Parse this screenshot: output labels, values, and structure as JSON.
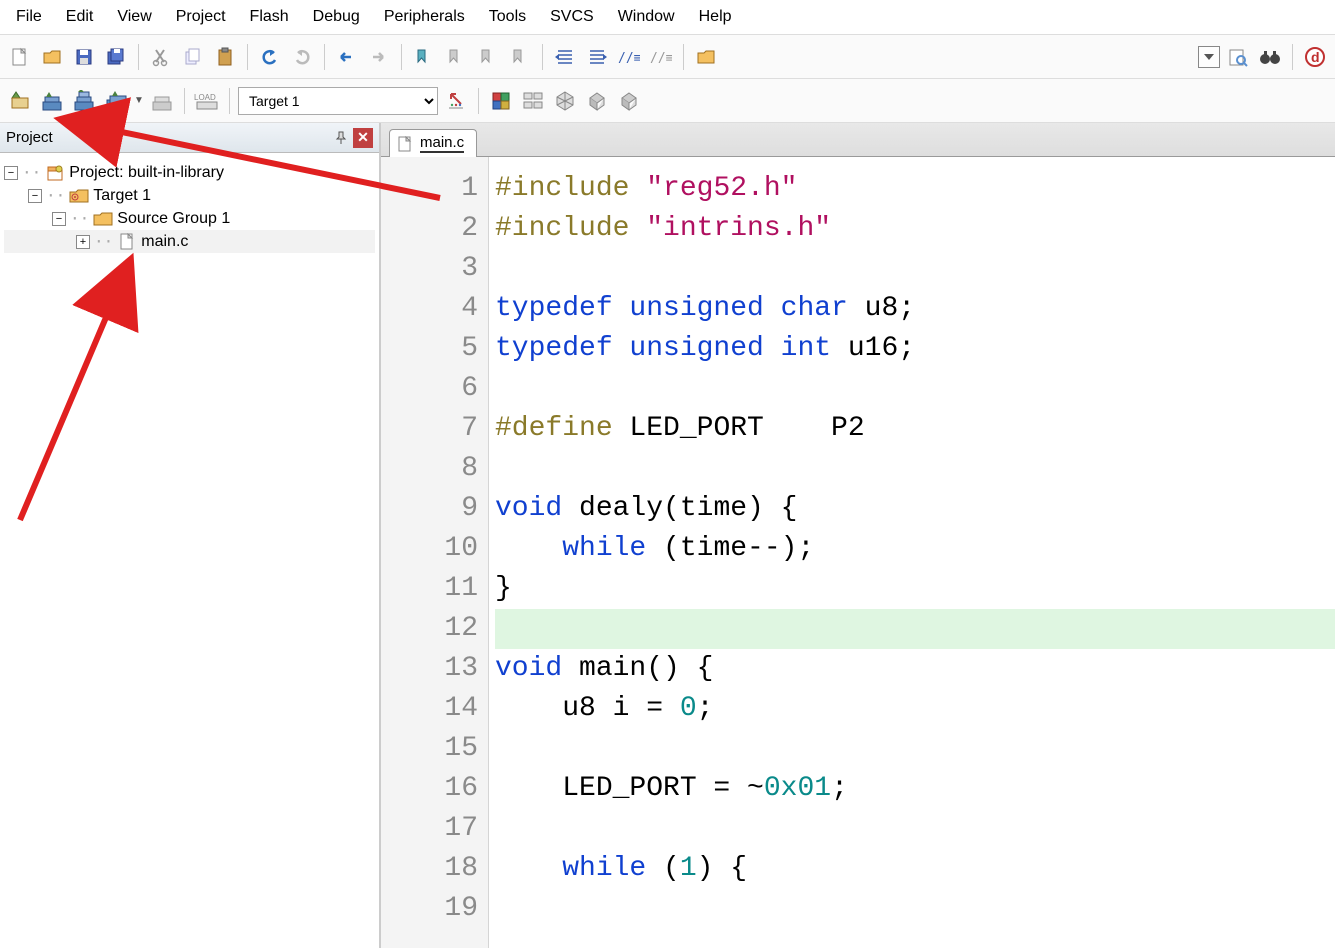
{
  "menu": [
    "File",
    "Edit",
    "View",
    "Project",
    "Flash",
    "Debug",
    "Peripherals",
    "Tools",
    "SVCS",
    "Window",
    "Help"
  ],
  "target_select": "Target 1",
  "sidebar": {
    "title": "Project",
    "project_label": "Project: built-in-library",
    "target_label": "Target 1",
    "group_label": "Source Group 1",
    "file_label": "main.c"
  },
  "tab": {
    "name": "main.c"
  },
  "code": {
    "lines": [
      {
        "n": 1,
        "frags": [
          {
            "t": "#include ",
            "c": "pp"
          },
          {
            "t": "\"reg52.h\"",
            "c": "str"
          }
        ]
      },
      {
        "n": 2,
        "frags": [
          {
            "t": "#include ",
            "c": "pp"
          },
          {
            "t": "\"intrins.h\"",
            "c": "str"
          }
        ]
      },
      {
        "n": 3,
        "frags": []
      },
      {
        "n": 4,
        "frags": [
          {
            "t": "typedef unsigned char",
            "c": "kw"
          },
          {
            "t": " u8;",
            "c": "id"
          }
        ]
      },
      {
        "n": 5,
        "frags": [
          {
            "t": "typedef unsigned int",
            "c": "kw"
          },
          {
            "t": " u16;",
            "c": "id"
          }
        ]
      },
      {
        "n": 6,
        "frags": []
      },
      {
        "n": 7,
        "frags": [
          {
            "t": "#define",
            "c": "pp"
          },
          {
            "t": " LED_PORT    P2",
            "c": "id"
          }
        ]
      },
      {
        "n": 8,
        "frags": []
      },
      {
        "n": 9,
        "frags": [
          {
            "t": "void",
            "c": "kw"
          },
          {
            "t": " dealy(time) {",
            "c": "id"
          }
        ]
      },
      {
        "n": 10,
        "frags": [
          {
            "t": "    ",
            "c": "id"
          },
          {
            "t": "while",
            "c": "kw"
          },
          {
            "t": " (time--);",
            "c": "id"
          }
        ]
      },
      {
        "n": 11,
        "frags": [
          {
            "t": "}",
            "c": "id"
          }
        ]
      },
      {
        "n": 12,
        "hl": true,
        "frags": []
      },
      {
        "n": 13,
        "frags": [
          {
            "t": "void",
            "c": "kw"
          },
          {
            "t": " main() {",
            "c": "id"
          }
        ]
      },
      {
        "n": 14,
        "frags": [
          {
            "t": "    u8 i = ",
            "c": "id"
          },
          {
            "t": "0",
            "c": "num"
          },
          {
            "t": ";",
            "c": "id"
          }
        ]
      },
      {
        "n": 15,
        "frags": []
      },
      {
        "n": 16,
        "frags": [
          {
            "t": "    LED_PORT = ~",
            "c": "id"
          },
          {
            "t": "0x01",
            "c": "num"
          },
          {
            "t": ";",
            "c": "id"
          }
        ]
      },
      {
        "n": 17,
        "frags": []
      },
      {
        "n": 18,
        "frags": [
          {
            "t": "    ",
            "c": "id"
          },
          {
            "t": "while",
            "c": "kw"
          },
          {
            "t": " (",
            "c": "id"
          },
          {
            "t": "1",
            "c": "num"
          },
          {
            "t": ") {",
            "c": "id"
          }
        ]
      },
      {
        "n": 19,
        "frags": []
      }
    ]
  }
}
